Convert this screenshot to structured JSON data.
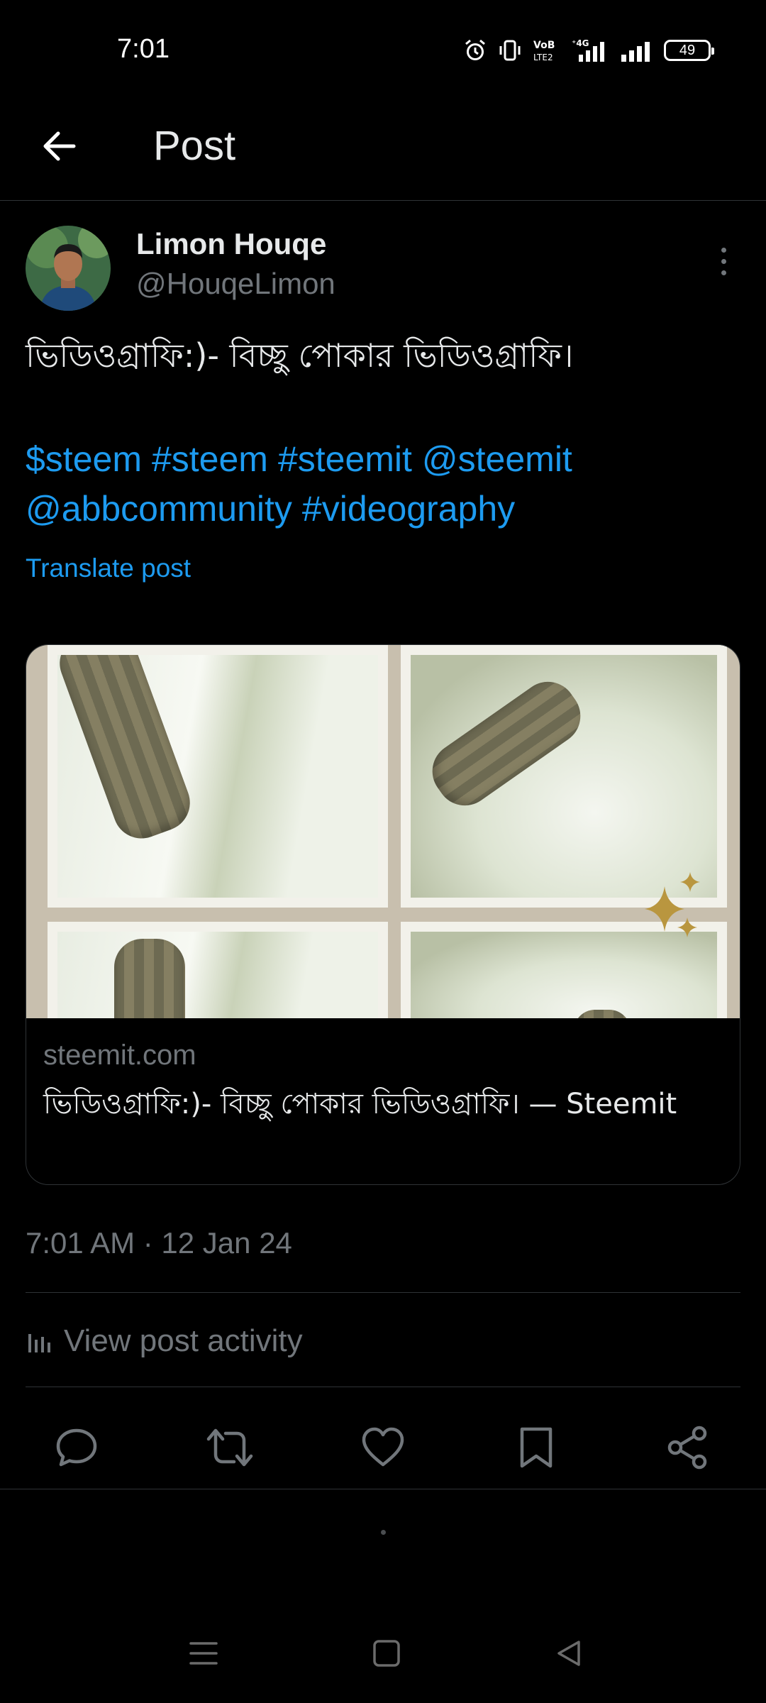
{
  "status_bar": {
    "time": "7:01",
    "battery": "49",
    "icons": [
      "alarm-icon",
      "vibrate-icon",
      "volte-icon",
      "signal-4g-icon",
      "signal-icon",
      "battery-icon"
    ]
  },
  "header": {
    "back_icon": "arrow-left-icon",
    "title": "Post"
  },
  "post": {
    "author_name": "Limon Houqe",
    "author_handle": "@HouqeLimon",
    "text": "ভিডিওগ্রাফি:)- বিচ্ছু পোকার ভিডিওগ্রাফি।",
    "tags": [
      "$steem",
      "#steem",
      "#steemit",
      "@steemit",
      "@abbcommunity",
      "#videography"
    ],
    "translate_label": "Translate post",
    "link_card": {
      "domain": "steemit.com",
      "title": "ভিডিওগ্রাফি:)- বিচ্ছু পোকার ভিডিওগ্রাফি। — Steemit"
    },
    "timestamp": "7:01 AM · 12 Jan 24",
    "activity_label": "View post activity"
  },
  "actions": [
    "reply-icon",
    "repost-icon",
    "like-icon",
    "bookmark-icon",
    "share-icon"
  ],
  "colors": {
    "background": "#000000",
    "text": "#e7e9ea",
    "muted": "#71767b",
    "link": "#1d9bf0",
    "border": "#2f3336"
  }
}
